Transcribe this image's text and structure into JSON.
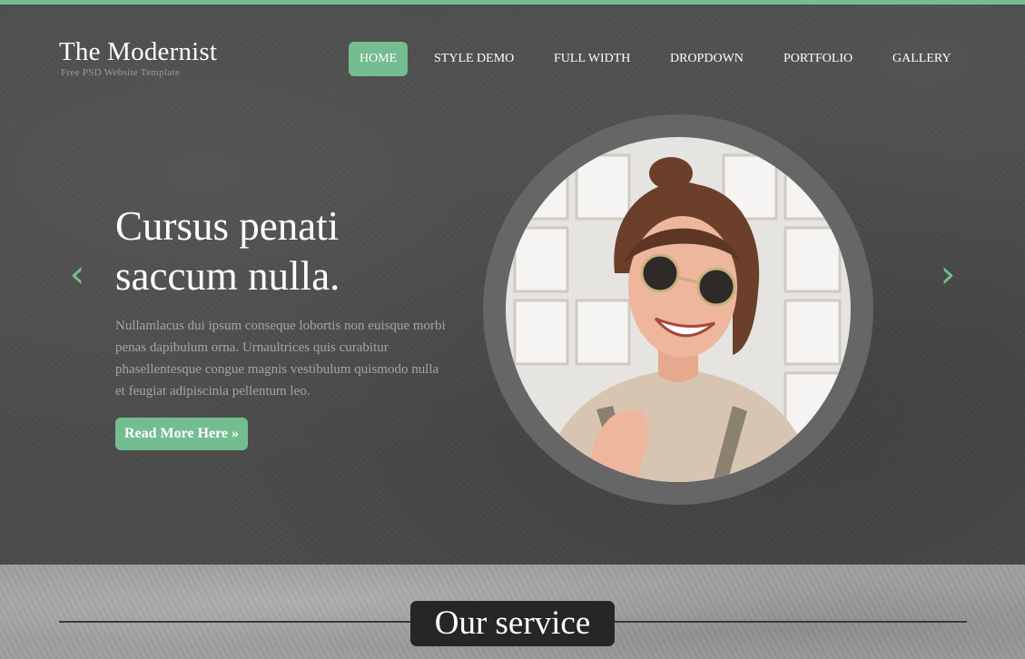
{
  "colors": {
    "accent": "#73bd90",
    "background": "#4b4b4b",
    "text": "#ffffff",
    "muted": "#a4a4a4"
  },
  "brand": {
    "title": "The Modernist",
    "subtitle": "Free PSD Website Template"
  },
  "nav": {
    "items": [
      "HOME",
      "STYLE DEMO",
      "FULL WIDTH",
      "DROPDOWN",
      "PORTFOLIO",
      "GALLERY"
    ],
    "active": "HOME"
  },
  "slider": {
    "prev_icon": "chevron-left-icon",
    "next_icon": "chevron-right-icon",
    "title_line1": "Cursus penati",
    "title_line2": "saccum nulla.",
    "body": "Nullamlacus dui ipsum conseque lobortis non euisque morbi penas dapibulum orna. Urnaultrices quis curabitur phasellentesque congue magnis vestibulum quismodo nulla et feugiat adipiscinia pellentum leo.",
    "button_label": "Read More Here »"
  },
  "services": {
    "title": "Our service"
  }
}
